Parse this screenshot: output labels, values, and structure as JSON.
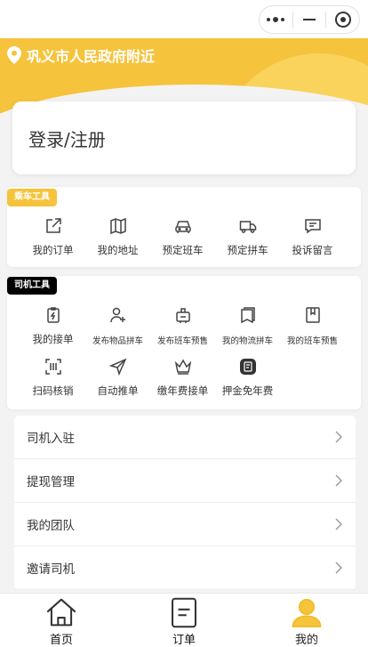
{
  "header": {
    "location": "巩义市人民政府附近"
  },
  "login": {
    "label": "登录/注册"
  },
  "passenger_tools": {
    "tag": "乘车工具",
    "items": [
      {
        "label": "我的订单",
        "icon": "external-link-icon"
      },
      {
        "label": "我的地址",
        "icon": "map-icon"
      },
      {
        "label": "预定班车",
        "icon": "car-icon"
      },
      {
        "label": "预定拼车",
        "icon": "truck-icon"
      },
      {
        "label": "投诉留言",
        "icon": "message-icon"
      }
    ]
  },
  "driver_tools": {
    "tag": "司机工具",
    "row1": [
      {
        "label": "我的接单",
        "icon": "clipboard-bolt-icon"
      },
      {
        "label": "发布物品拼车",
        "icon": "user-plus-icon"
      },
      {
        "label": "发布班车预售",
        "icon": "luggage-icon"
      },
      {
        "label": "我的物流拼车",
        "icon": "pages-icon"
      },
      {
        "label": "我的班车预售",
        "icon": "bookmark-icon"
      }
    ],
    "row2": [
      {
        "label": "扫码核销",
        "icon": "scan-icon"
      },
      {
        "label": "自动推单",
        "icon": "send-icon"
      },
      {
        "label": "缴年费接单",
        "icon": "crown-icon"
      },
      {
        "label": "押金免年费",
        "icon": "deposit-icon"
      }
    ]
  },
  "menu": [
    {
      "label": "司机入驻"
    },
    {
      "label": "提现管理"
    },
    {
      "label": "我的团队"
    },
    {
      "label": "邀请司机"
    }
  ],
  "tabbar": [
    {
      "label": "首页",
      "icon": "home-icon"
    },
    {
      "label": "订单",
      "icon": "order-icon"
    },
    {
      "label": "我的",
      "icon": "profile-icon"
    }
  ],
  "colors": {
    "accent": "#f6c33c",
    "driver_tag": "#000000"
  }
}
